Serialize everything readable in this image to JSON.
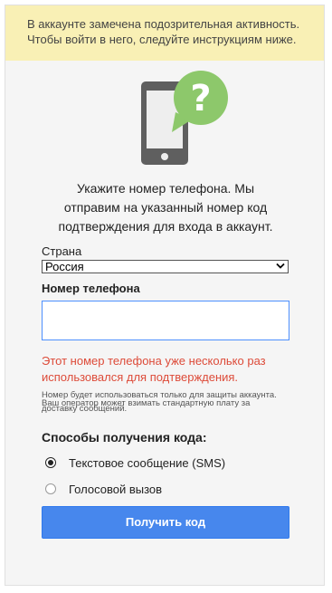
{
  "warning": {
    "line1": "В аккаунте замечена подозрительная активность.",
    "line2": "Чтобы войти в него, следуйте инструкциям ниже."
  },
  "illustration": {
    "icon": "phone-question-icon",
    "phone_color": "#5f5f5f",
    "bubble_color": "#8dc86b",
    "bubble_symbol": "?"
  },
  "intro": {
    "line1": "Укажите номер телефона. Мы",
    "line2": "отправим на указанный номер код",
    "line3": "подтверждения для входа в аккаунт."
  },
  "country": {
    "label": "Страна",
    "selected": "Россия"
  },
  "phone": {
    "label": "Номер телефона",
    "value": "",
    "placeholder": ""
  },
  "error": {
    "line1": "Этот номер телефона уже несколько раз",
    "line2": "использовался для подтверждения.",
    "color": "#dd4b39"
  },
  "note": {
    "line1": "Номер будет использоваться только для защиты аккаунта.",
    "line2": "Ваш оператор может взимать стандартную плату за",
    "line3": "доставку сообщений."
  },
  "methods": {
    "title": "Способы получения кода:",
    "options": [
      {
        "label": "Текстовое сообщение (SMS)",
        "selected": true
      },
      {
        "label": "Голосовой вызов",
        "selected": false
      }
    ]
  },
  "submit": {
    "label": "Получить код",
    "color": "#4787ed"
  }
}
